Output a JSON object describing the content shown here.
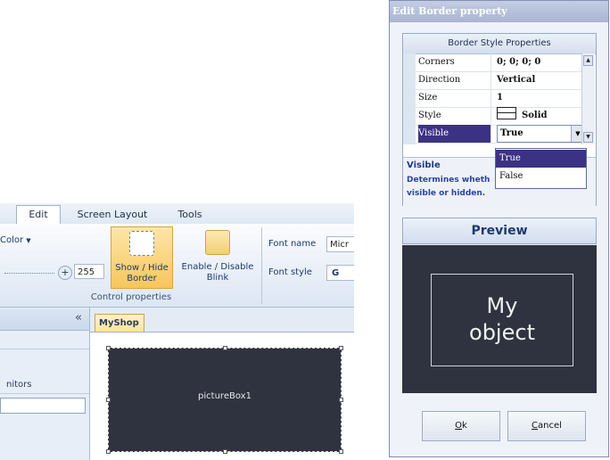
{
  "editor": {
    "tabs": [
      "Edit",
      "Screen Layout",
      "Tools"
    ],
    "ribbon": {
      "color_label": "Color",
      "slider_value": "255",
      "show_hide_border": "Show / Hide\nBorder",
      "enable_disable_blink": "Enable / Disable\nBlink",
      "group_label": "Control properties",
      "font_name_label": "Font name",
      "font_name_value": "Micr",
      "font_style_label": "Font style",
      "font_style_value": "G"
    },
    "sidepanel": {
      "collapse_glyph": "«",
      "monitors_label": "nitors"
    },
    "document_tab": "MyShop",
    "picturebox_label": "pictureBox1"
  },
  "dialog": {
    "title": "Edit Border property",
    "grid_header": "Border Style Properties",
    "properties": [
      {
        "name": "Corners",
        "value": "0; 0; 0; 0"
      },
      {
        "name": "Direction",
        "value": "Vertical"
      },
      {
        "name": "Size",
        "value": "1"
      },
      {
        "name": "Style",
        "value": "Solid"
      },
      {
        "name": "Visible",
        "value": "True"
      }
    ],
    "dropdown_options": [
      "True",
      "False"
    ],
    "selected_option": "True",
    "description_title": "Visible",
    "description_text": "Determines wheth visible or hidden.",
    "preview_label": "Preview",
    "preview_object_text": "My\nobject",
    "ok_button": "Ok",
    "ok_mnemonic": "O",
    "ok_rest": "k",
    "cancel_button": "Cancel",
    "cancel_mnemonic": "C",
    "cancel_rest": "ancel",
    "icons": [
      "scroll-up-icon",
      "scroll-down-icon",
      "dropdown-arrow-icon",
      "style-line-icon",
      "collapse-icon",
      "plus-icon",
      "border-icon",
      "blink-icon"
    ]
  },
  "colors": {
    "selection": "#3c3284",
    "canvas": "#2f3340",
    "ribbon_highlight": "#f7c65c"
  }
}
